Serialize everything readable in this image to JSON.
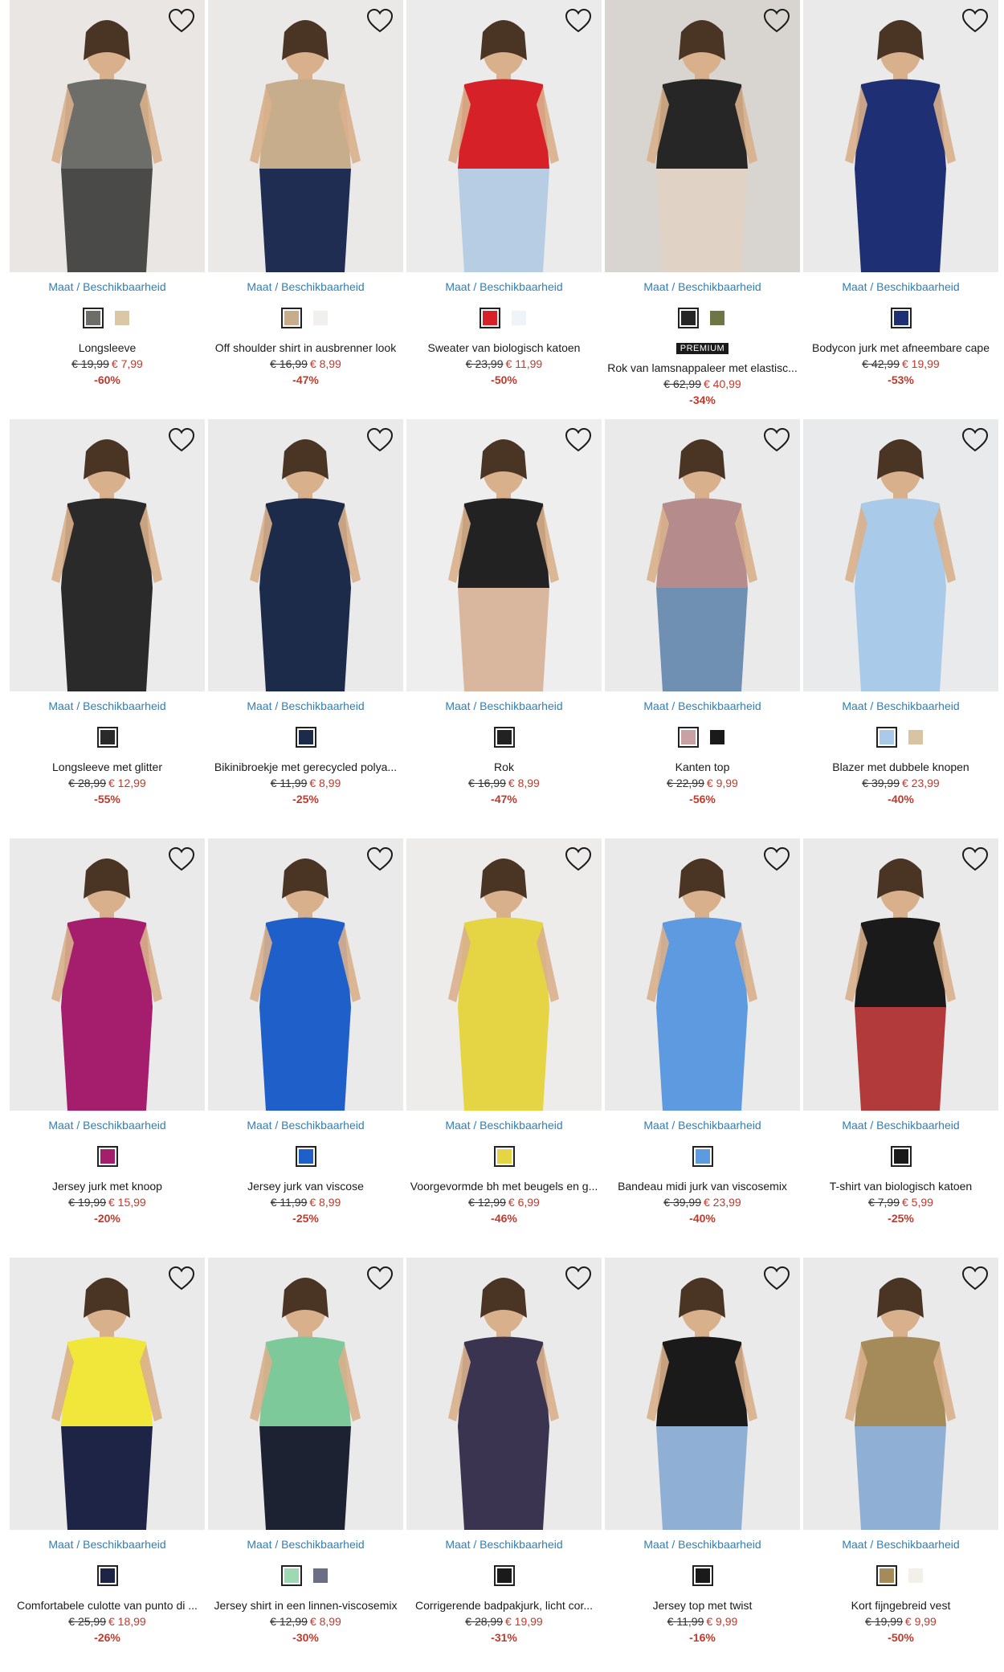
{
  "heart_icon": "heart-outline-icon",
  "size_label": "Maat / Beschikbaarheid",
  "products": [
    {
      "title": "Longsleeve",
      "old_price": "€ 19,99",
      "new_price": "€ 7,99",
      "discount": "-60%",
      "bg": "#e9e6e4",
      "garment": "#6d6d6a",
      "lower": "#4a4a48",
      "swatches": [
        "#6d6d6a",
        "#d9c7a6"
      ]
    },
    {
      "title": "Off shoulder shirt in ausbrenner look",
      "old_price": "€ 16,99",
      "new_price": "€ 8,99",
      "discount": "-47%",
      "bg": "#ebe9e8",
      "garment": "#c7ad8c",
      "lower": "#1f2d52",
      "swatches": [
        "#c7ad8c",
        "#f2f0ee"
      ]
    },
    {
      "title": "Sweater van biologisch katoen",
      "old_price": "€ 23,99",
      "new_price": "€ 11,99",
      "discount": "-50%",
      "bg": "#ecebeb",
      "garment": "#d62128",
      "lower": "#b7cde3",
      "swatches": [
        "#d62128",
        "#eef4f8"
      ]
    },
    {
      "title": "Rok van lamsnappaleer met elastisc...",
      "old_price": "€ 62,99",
      "new_price": "€ 40,99",
      "discount": "-34%",
      "badge": "PREMIUM",
      "bg": "#d8d4d0",
      "garment": "#262626",
      "lower": "#e0d3c5",
      "swatches": [
        "#262626",
        "#6f7645"
      ]
    },
    {
      "title": "Bodycon jurk met afneembare cape",
      "old_price": "€ 42,99",
      "new_price": "€ 19,99",
      "discount": "-53%",
      "bg": "#ebeaea",
      "garment": "#1f2f73",
      "lower": "#1f2f73",
      "swatches": [
        "#1f2f73"
      ]
    },
    {
      "title": "Longsleeve met glitter",
      "old_price": "€ 28,99",
      "new_price": "€ 12,99",
      "discount": "-55%",
      "bg": "#ecebeb",
      "garment": "#2a2a2a",
      "lower": "#2a2a2a",
      "swatches": [
        "#2a2a2a"
      ]
    },
    {
      "title": "Bikinibroekje met gerecycled polya...",
      "old_price": "€ 11,99",
      "new_price": "€ 8,99",
      "discount": "-25%",
      "bg": "#ebeaea",
      "garment": "#1c2b4a",
      "lower": "#1c2b4a",
      "swatches": [
        "#1c2b4a"
      ]
    },
    {
      "title": "Rok",
      "old_price": "€ 16,99",
      "new_price": "€ 8,99",
      "discount": "-47%",
      "bg": "#eeeeee",
      "garment": "#222222",
      "lower": "#d9b79f",
      "swatches": [
        "#222222"
      ]
    },
    {
      "title": "Kanten top",
      "old_price": "€ 22,99",
      "new_price": "€ 9,99",
      "discount": "-56%",
      "bg": "#ebeaea",
      "garment": "#b58b8b",
      "lower": "#6f8fb3",
      "swatches": [
        "#c9a0a3",
        "#1a1a1a"
      ]
    },
    {
      "title": "Blazer met dubbele knopen",
      "old_price": "€ 39,99",
      "new_price": "€ 23,99",
      "discount": "-40%",
      "bg": "#e9eaec",
      "garment": "#a9cbe9",
      "lower": "#a9cbe9",
      "swatches": [
        "#a9cbe9",
        "#d8c3a3"
      ]
    },
    {
      "title": "Jersey jurk met knoop",
      "old_price": "€ 19,99",
      "new_price": "€ 15,99",
      "discount": "-20%",
      "bg": "#ebeaea",
      "garment": "#a51e6e",
      "lower": "#a51e6e",
      "swatches": [
        "#a51e6e"
      ]
    },
    {
      "title": "Jersey jurk van viscose",
      "old_price": "€ 11,99",
      "new_price": "€ 8,99",
      "discount": "-25%",
      "bg": "#ebeaea",
      "garment": "#1e5fc9",
      "lower": "#1e5fc9",
      "swatches": [
        "#1e5fc9"
      ]
    },
    {
      "title": "Voorgevormde bh met beugels en g...",
      "old_price": "€ 12,99",
      "new_price": "€ 6,99",
      "discount": "-46%",
      "bg": "#eeeceb",
      "garment": "#e5d443",
      "lower": "#e5d443",
      "swatches": [
        "#e5d443"
      ]
    },
    {
      "title": "Bandeau midi jurk van viscosemix",
      "old_price": "€ 39,99",
      "new_price": "€ 23,99",
      "discount": "-40%",
      "bg": "#ebeaea",
      "garment": "#5d9ae0",
      "lower": "#5d9ae0",
      "swatches": [
        "#5d9ae0"
      ]
    },
    {
      "title": "T-shirt van biologisch katoen",
      "old_price": "€ 7,99",
      "new_price": "€ 5,99",
      "discount": "-25%",
      "bg": "#ebeaea",
      "garment": "#1a1a1a",
      "lower": "#b33a3a",
      "swatches": [
        "#1a1a1a"
      ]
    },
    {
      "title": "Comfortabele culotte van punto di ...",
      "old_price": "€ 25,99",
      "new_price": "€ 18,99",
      "discount": "-26%",
      "bg": "#ebeaea",
      "garment": "#f0e73a",
      "lower": "#1d2445",
      "swatches": [
        "#1d2445"
      ]
    },
    {
      "title": "Jersey shirt in een linnen-viscosemix",
      "old_price": "€ 12,99",
      "new_price": "€ 8,99",
      "discount": "-30%",
      "bg": "#ebeaea",
      "garment": "#7ec99a",
      "lower": "#1d2233",
      "swatches": [
        "#9fd9b3",
        "#6b6f86"
      ]
    },
    {
      "title": "Corrigerende badpakjurk, licht cor...",
      "old_price": "€ 28,99",
      "new_price": "€ 19,99",
      "discount": "-31%",
      "bg": "#ebeaea",
      "garment": "#3b3450",
      "lower": "#3b3450",
      "swatches": [
        "#1a1a1a"
      ]
    },
    {
      "title": "Jersey top met twist",
      "old_price": "€ 11,99",
      "new_price": "€ 9,99",
      "discount": "-16%",
      "bg": "#ebeaea",
      "garment": "#1a1a1a",
      "lower": "#8fb0d4",
      "swatches": [
        "#1a1a1a"
      ]
    },
    {
      "title": "Kort fijngebreid vest",
      "old_price": "€ 19,99",
      "new_price": "€ 9,99",
      "discount": "-50%",
      "bg": "#ebeaea",
      "garment": "#a58a5a",
      "lower": "#8fb0d4",
      "swatches": [
        "#a58a5a",
        "#f2f0e8"
      ]
    }
  ]
}
